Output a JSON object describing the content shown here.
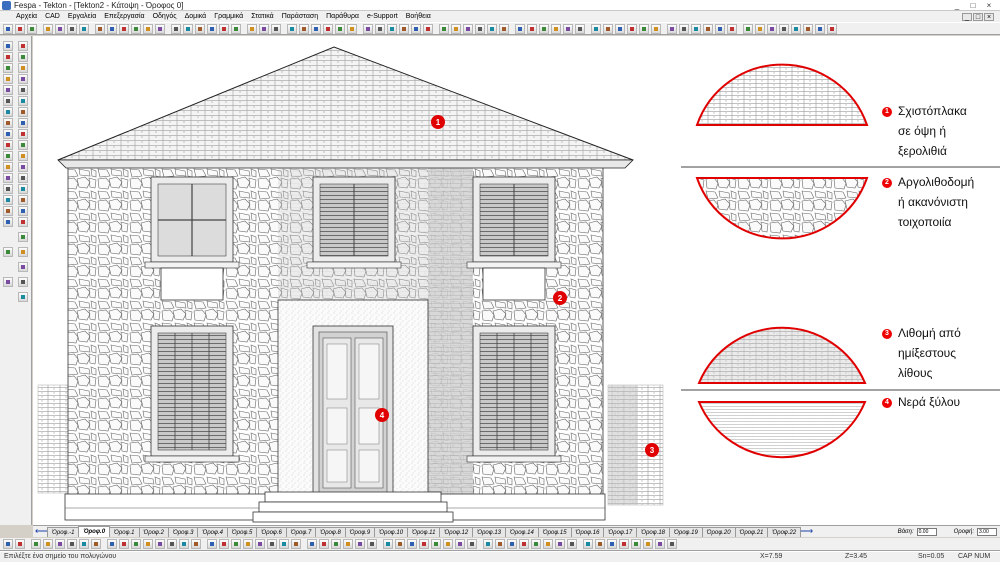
{
  "window": {
    "title": "Fespa - Tekton - [Tekton2 - Κάτοψη - Όροφος 0]",
    "controls": [
      "_",
      "□",
      "×"
    ],
    "mdi_controls": [
      "_",
      "□",
      "×"
    ]
  },
  "menu": [
    "Αρχεία",
    "CAD",
    "Εργαλεία",
    "Επεξεργασία",
    "Οδηγός",
    "Δομικά",
    "Γραμμικά",
    "Στατικά",
    "Παράσταση",
    "Παράθυρα",
    "e-Support",
    "Βοήθεια"
  ],
  "colors": {
    "accent": "#e10000",
    "tab_arrow": "#1c3fa8"
  },
  "drawing": {
    "markers": [
      "1",
      "2",
      "3",
      "4"
    ]
  },
  "legend": [
    {
      "num": "1",
      "lines": [
        "Σχιστόπλακα",
        "σε όψη ή",
        "ξερολιθιά"
      ],
      "pattern": "slate"
    },
    {
      "num": "2",
      "lines": [
        "Αργολιθοδομή",
        "ή ακανόνιστη",
        "τοιχοποιία"
      ],
      "pattern": "rubble"
    },
    {
      "num": "3",
      "lines": [
        "Λιθομή από",
        "ημίξεστους",
        "λίθους"
      ],
      "pattern": "ashlar"
    },
    {
      "num": "4",
      "lines": [
        "Νερά ξύλου"
      ],
      "pattern": "wood"
    }
  ],
  "floor_tabs": {
    "nav": [
      "⟵",
      "⟶"
    ],
    "active": "Όροφ.0",
    "tabs": [
      "Όροφ.-1",
      "Όροφ.0",
      "Όροφ.1",
      "Όροφ.2",
      "Όροφ.3",
      "Όροφ.4",
      "Όροφ.5",
      "Όροφ.6",
      "Όροφ.7",
      "Όροφ.8",
      "Όροφ.9",
      "Όροφ.10",
      "Όροφ.11",
      "Όροφ.12",
      "Όροφ.13",
      "Όροφ.14",
      "Όροφ.15",
      "Όροφ.16",
      "Όροφ.17",
      "Όροφ.18",
      "Όροφ.19",
      "Όροφ.20",
      "Όροφ.21",
      "Όροφ.22"
    ],
    "base_label": "Βάση:",
    "base_value": "0.00",
    "roof_label": "Οροφή:",
    "roof_value": "3.00"
  },
  "status": {
    "prompt": "Επιλέξτε ένα σημείο του πολυγώνου",
    "x": "X=7.59",
    "z": "Z=3.45",
    "snap": "Sn=0.05",
    "flags": "CAP  NUM"
  }
}
